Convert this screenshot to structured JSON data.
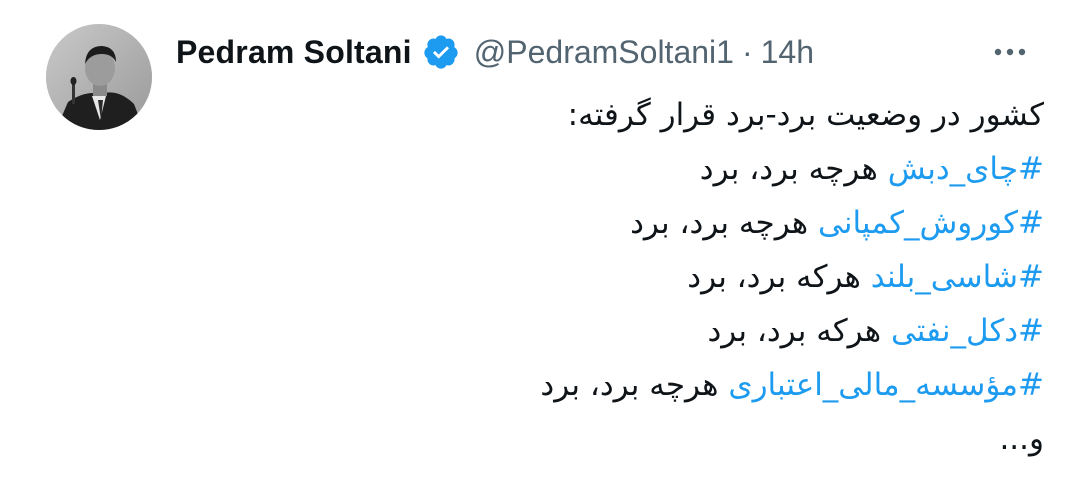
{
  "author": {
    "display_name": "Pedram Soltani",
    "handle": "@PedramSoltani1",
    "separator": "·",
    "time": "14h",
    "verified_icon": "verified-badge-icon",
    "avatar_icon": "profile-photo"
  },
  "more_icon": "more-options-icon",
  "colors": {
    "link": "#1d9bf0",
    "verified": "#1d9bf0",
    "secondary_text": "#536471",
    "primary_text": "#0f1419"
  },
  "tweet": {
    "intro": "کشور در وضعیت برد-برد قرار گرفته:",
    "lines": [
      {
        "hashtag": "#چای_دبش",
        "text": " هرچه برد، برد"
      },
      {
        "hashtag": "#کوروش_کمپانی",
        "text": " هرچه برد، برد"
      },
      {
        "hashtag": "#شاسی_بلند",
        "text": " هرکه برد، برد"
      },
      {
        "hashtag": "#دکل_نفتی",
        "text": " هرکه برد، برد"
      },
      {
        "hashtag": "#مؤسسه_مالی_اعتباری",
        "text": " هرچه برد، برد"
      }
    ],
    "ending": "و..."
  }
}
